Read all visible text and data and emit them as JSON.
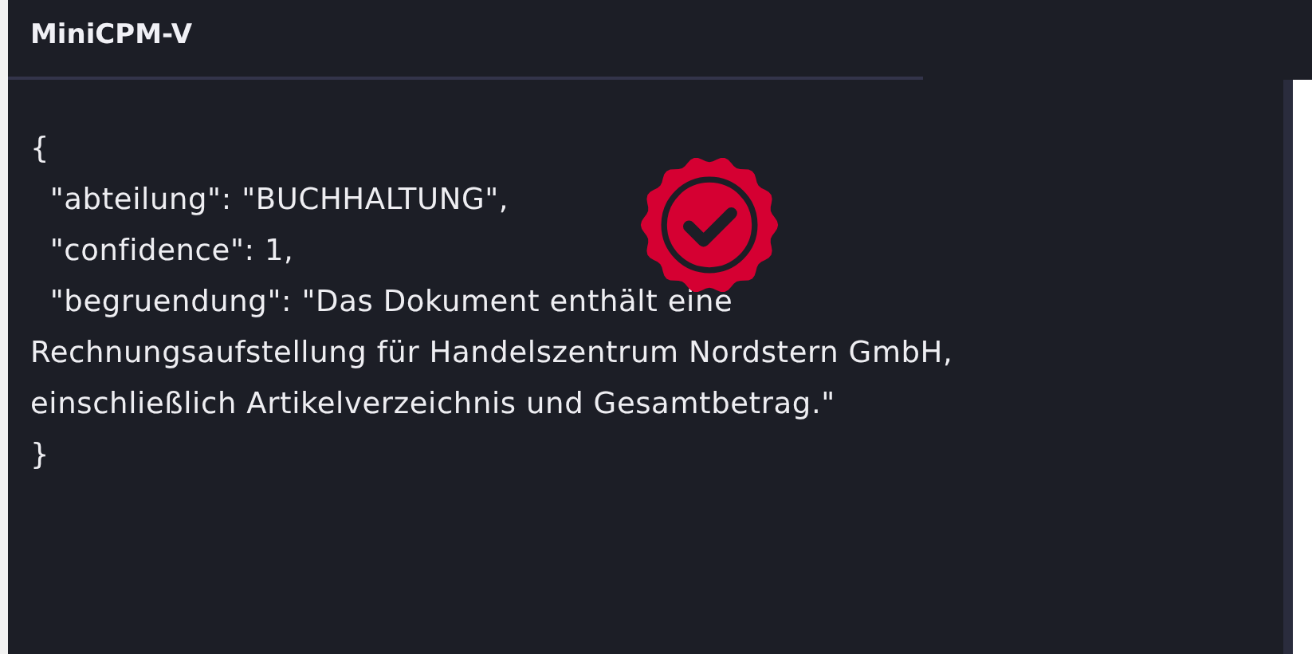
{
  "panel": {
    "title": "MiniCPM-V",
    "response_lines": [
      "{",
      "  \"abteilung\": \"BUCHHALTUNG\",",
      "  \"confidence\": 1,",
      "  \"begruendung\": \"Das Dokument enthält eine",
      "Rechnungsaufstellung für Handelszentrum Nordstern GmbH,",
      "einschließlich Artikelverzeichnis und Gesamtbetrag.\"",
      "}"
    ]
  }
}
